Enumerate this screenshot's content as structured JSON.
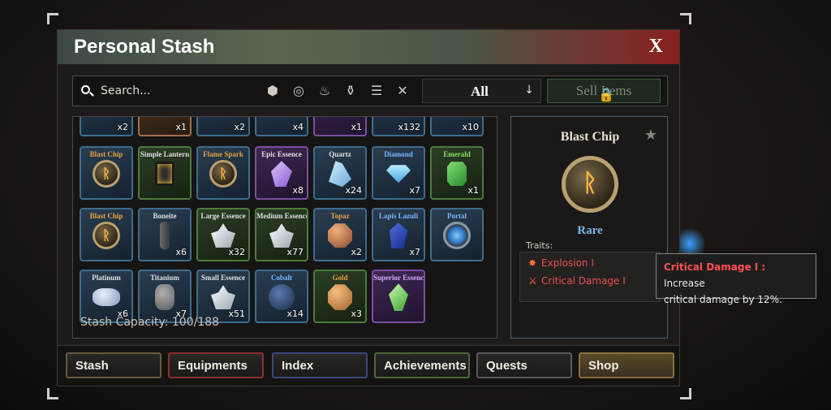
{
  "window": {
    "title": "Personal Stash",
    "close_label": "X"
  },
  "toolbar": {
    "search_placeholder": "Search...",
    "filter_icons": [
      "ore-filter-icon",
      "rune-filter-icon",
      "flame-filter-icon",
      "potion-filter-icon",
      "sort-icon",
      "collapse-icon"
    ],
    "dropdown_value": "All",
    "sell_label": "Sell Items"
  },
  "grid": {
    "partial_row": [
      {
        "count": "x2",
        "color": "blue"
      },
      {
        "count": "x1",
        "color": "orange"
      },
      {
        "count": "x2",
        "color": "blue"
      },
      {
        "count": "x4",
        "color": "blue"
      },
      {
        "count": "x1",
        "color": "purple"
      },
      {
        "count": "x132",
        "color": "blue"
      },
      {
        "count": "x10",
        "color": "blue"
      }
    ],
    "rows": [
      [
        {
          "name": "Blast Chip",
          "count": "",
          "frame": "blue",
          "name_color": "orange",
          "art": "coin"
        },
        {
          "name": "Simple Lantern",
          "count": "",
          "frame": "green",
          "name_color": "white",
          "art": "lantern"
        },
        {
          "name": "Flame Spark",
          "count": "",
          "frame": "blue",
          "name_color": "orange",
          "art": "coin"
        },
        {
          "name": "Epic Essence",
          "count": "x8",
          "frame": "purple",
          "name_color": "white",
          "art": "crystal-purple"
        },
        {
          "name": "Quartz",
          "count": "x24",
          "frame": "blue",
          "name_color": "white",
          "art": "crystal-blue"
        },
        {
          "name": "Diamond",
          "count": "x7",
          "frame": "blue",
          "name_color": "blue",
          "art": "diamond"
        },
        {
          "name": "Emerald",
          "count": "x1",
          "frame": "green",
          "name_color": "green",
          "art": "emerald"
        }
      ],
      [
        {
          "name": "Blast Chip",
          "count": "",
          "frame": "blue",
          "name_color": "orange",
          "art": "coin"
        },
        {
          "name": "Boneite",
          "count": "x6",
          "frame": "blue",
          "name_color": "white",
          "art": "bone"
        },
        {
          "name": "Large Essence",
          "count": "x32",
          "frame": "green",
          "name_color": "white",
          "art": "crystal-white"
        },
        {
          "name": "Medium Essence",
          "count": "x77",
          "frame": "green",
          "name_color": "white",
          "art": "crystal-white"
        },
        {
          "name": "Topaz",
          "count": "x2",
          "frame": "blue",
          "name_color": "orange",
          "art": "topaz"
        },
        {
          "name": "Lapis Lazuli",
          "count": "x7",
          "frame": "blue",
          "name_color": "blue",
          "art": "lapis"
        },
        {
          "name": "Portal",
          "count": "",
          "frame": "blue",
          "name_color": "blue",
          "art": "portal"
        }
      ],
      [
        {
          "name": "Platinum",
          "count": "x6",
          "frame": "blue",
          "name_color": "white",
          "art": "platinum"
        },
        {
          "name": "Titanium",
          "count": "x7",
          "frame": "blue",
          "name_color": "white",
          "art": "titanium"
        },
        {
          "name": "Small Essence",
          "count": "x51",
          "frame": "blue",
          "name_color": "white",
          "art": "crystal-white"
        },
        {
          "name": "Cobalt",
          "count": "x14",
          "frame": "blue",
          "name_color": "blue",
          "art": "cobalt"
        },
        {
          "name": "Gold",
          "count": "x3",
          "frame": "green",
          "name_color": "orange",
          "art": "gold"
        },
        {
          "name": "Superior Essence",
          "count": "",
          "frame": "purple",
          "name_color": "purple",
          "art": "crystal-green"
        }
      ]
    ],
    "capacity_label": "Stash Capacity: 100/188"
  },
  "detail": {
    "name": "Blast Chip",
    "rarity": "Rare",
    "traits_label": "Traits:",
    "traits": [
      "Explosion I",
      "Critical Damage I"
    ]
  },
  "tooltip": {
    "title": "Critical Damage I :",
    "text_lead": "Increase",
    "text_rest": "critical damage by 12%."
  },
  "tabs": [
    {
      "label": "Stash",
      "color": "#6a5a40"
    },
    {
      "label": "Equipments",
      "color": "#8a3030"
    },
    {
      "label": "Index",
      "color": "#3a4a7a"
    },
    {
      "label": "Achievements",
      "color": "#4a6a3a"
    },
    {
      "label": "Quests",
      "color": "#5a5a5a"
    },
    {
      "label": "Shop",
      "color": "#8a7040"
    }
  ]
}
